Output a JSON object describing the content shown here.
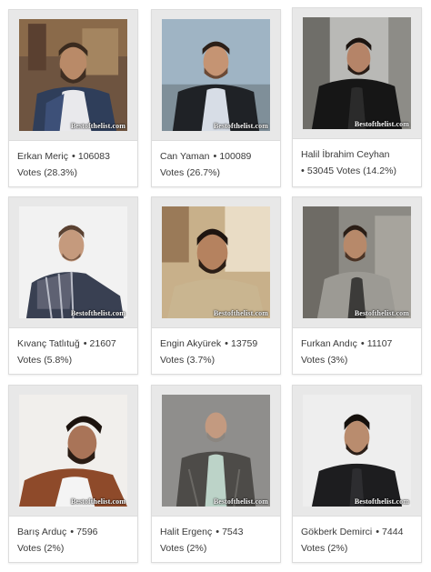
{
  "watermark": "Bestofthelist.com",
  "cards": [
    {
      "name": "Erkan Meriç",
      "votes": "106083",
      "pct_line": "Votes (28.3%)"
    },
    {
      "name": "Can Yaman",
      "votes": "100089",
      "pct_line": "Votes (26.7%)"
    },
    {
      "name": "Halil İbrahim Ceyhan",
      "votes": "53045",
      "pct_line": "Votes (14.2%)"
    },
    {
      "name": "Kıvanç Tatlıtuğ",
      "votes": "21607",
      "pct_line": "Votes (5.8%)"
    },
    {
      "name": "Engin Akyürek",
      "votes": "13759",
      "pct_line": "Votes (3.7%)"
    },
    {
      "name": "Furkan Andıç",
      "votes": "11107",
      "pct_line": "Votes (3%)"
    },
    {
      "name": "Barış Arduç",
      "votes": "7596",
      "pct_line": "Votes (2%)"
    },
    {
      "name": "Halit Ergenç",
      "votes": "7543",
      "pct_line": "Votes (2%)"
    },
    {
      "name": "Gökberk Demirci",
      "votes": "7444",
      "pct_line": "Votes (2%)"
    }
  ]
}
